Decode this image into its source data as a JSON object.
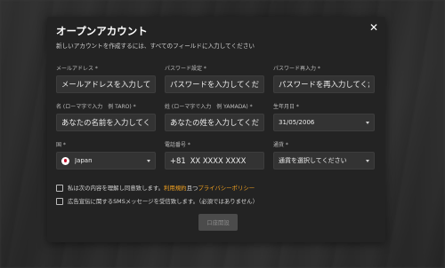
{
  "modal": {
    "title": "オープンアカウント",
    "subtitle": "新しいアカウントを作成するには、すべてのフィールドに入力してください",
    "close_icon": "close-icon"
  },
  "fields": {
    "email": {
      "label": "メールアドレス *",
      "placeholder": "メールアドレスを入力してください"
    },
    "password": {
      "label": "パスワード設定 *",
      "placeholder": "パスワードを入力してください"
    },
    "password_confirm": {
      "label": "パスワード再入力 *",
      "placeholder": "パスワードを再入力してください"
    },
    "first_name": {
      "label": "名 (ローマ字で入力　例 TARO) *",
      "placeholder": "あなたの名前を入力してください"
    },
    "last_name": {
      "label": "姓 (ローマ字で入力　例 YAMADA) *",
      "placeholder": "あなたの姓を入力してください"
    },
    "birthdate": {
      "label": "生年月日 *",
      "value": "31/05/2006"
    },
    "country": {
      "label": "国 *",
      "value": "Japan",
      "flag_icon": "japan-flag-icon"
    },
    "phone": {
      "label": "電話番号 *",
      "country_code": "+81",
      "placeholder": "XX XXXX XXXX"
    },
    "currency": {
      "label": "通貨 *",
      "value": "通貨を選択してください"
    }
  },
  "agreements": {
    "terms_prefix": "私は次の内容を理解し同意致します。",
    "terms_link": "利用規約",
    "terms_and": "且つ",
    "privacy_link": "プライバシーポリシー",
    "marketing": "広告宣伝に関するSMSメッセージを受信致します。（必須ではありません）"
  },
  "submit_label": "口座開設",
  "colors": {
    "accent": "#f0a020",
    "modal_bg": "#232323",
    "input_bg": "#333333"
  }
}
